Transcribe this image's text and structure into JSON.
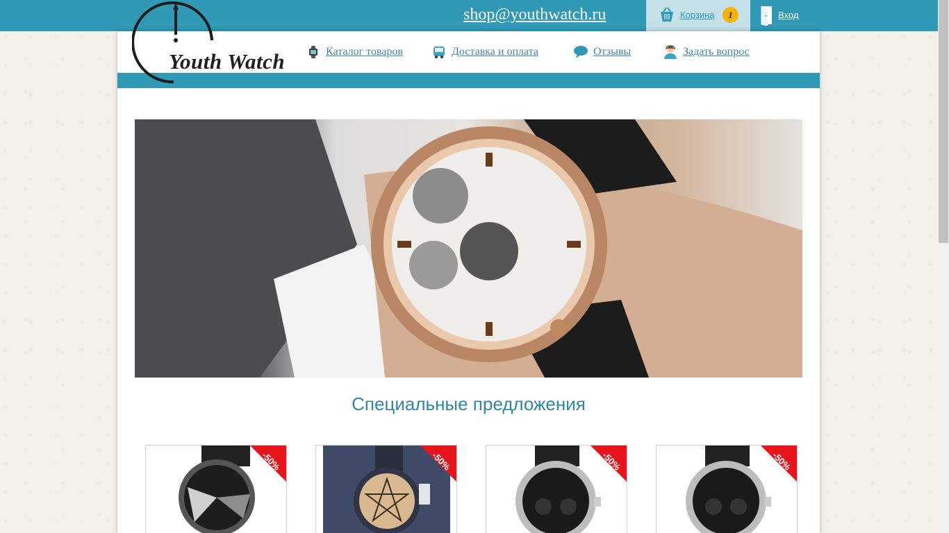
{
  "header": {
    "email": "shop@youthwatch.ru",
    "cart_label": "Корзина",
    "cart_count": "1",
    "login_label": "Вход"
  },
  "logo": {
    "text": "Youth Watch"
  },
  "nav": {
    "items": [
      {
        "label": "Каталог товаров",
        "icon": "watch-icon"
      },
      {
        "label": "Доставка и оплата",
        "icon": "bus-icon"
      },
      {
        "label": "Отзывы",
        "icon": "speech-bubble-icon"
      },
      {
        "label": "Задать вопрос",
        "icon": "support-agent-icon"
      }
    ]
  },
  "hero": {
    "image": "luxury-wristwatch-photo"
  },
  "main": {
    "section_title": "Специальные предложения",
    "products": [
      {
        "badge": "-50%",
        "image": "silver-black-watch"
      },
      {
        "badge": "-50%",
        "image": "pentagram-dial-watch"
      },
      {
        "badge": "-50%",
        "image": "invicta-black-watch"
      },
      {
        "badge": "-50%",
        "image": "invicta-black-watch"
      }
    ]
  },
  "colors": {
    "brand": "#2f99b6",
    "link": "#3f86a8",
    "badge": "#e8141c",
    "cart_count_bg": "#f6b400"
  }
}
